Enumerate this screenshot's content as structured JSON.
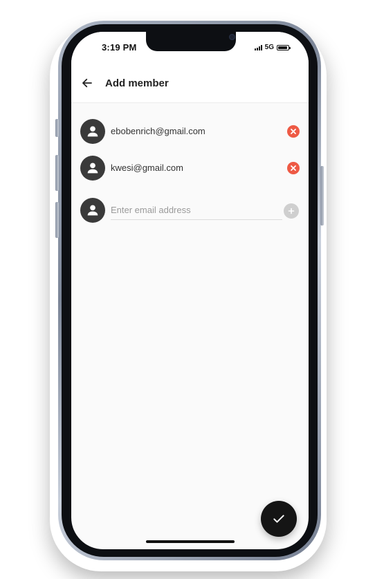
{
  "status_bar": {
    "time": "3:19 PM",
    "network": "5G"
  },
  "app_bar": {
    "back_icon": "arrow-left-icon",
    "title": "Add member"
  },
  "members": [
    {
      "email": "ebobenrich@gmail.com",
      "avatar_icon": "person-icon",
      "remove_icon": "close-icon"
    },
    {
      "email": "kwesi@gmail.com",
      "avatar_icon": "person-icon",
      "remove_icon": "close-icon"
    }
  ],
  "new_member": {
    "placeholder": "Enter email address",
    "value": "",
    "add_icon": "plus-icon"
  },
  "fab": {
    "icon": "check-icon"
  },
  "colors": {
    "remove": "#ee5a45",
    "avatar": "#3a3a3a",
    "fab": "#151515",
    "add_disabled": "#cfcfcf",
    "screen_bg": "#fafafa"
  }
}
